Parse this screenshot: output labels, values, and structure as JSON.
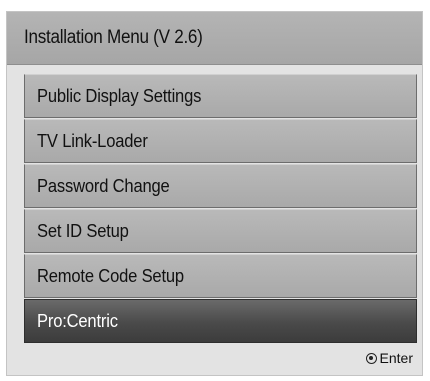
{
  "menu": {
    "title": "Installation Menu (V 2.6)",
    "items": [
      {
        "label": "Public Display Settings",
        "selected": false
      },
      {
        "label": "TV Link-Loader",
        "selected": false
      },
      {
        "label": "Password Change",
        "selected": false
      },
      {
        "label": "Set ID Setup",
        "selected": false
      },
      {
        "label": "Remote Code Setup",
        "selected": false
      },
      {
        "label": "Pro:Centric",
        "selected": true
      }
    ]
  },
  "footer": {
    "enter_icon": "ok-button-icon",
    "enter_label": "Enter"
  },
  "colors": {
    "panel_bg": "#e3e3e3",
    "title_bar": "#adadad",
    "item_bg": "#b1b1b1",
    "selected_bg": "#4a4a4a",
    "selected_text": "#ffffff"
  }
}
